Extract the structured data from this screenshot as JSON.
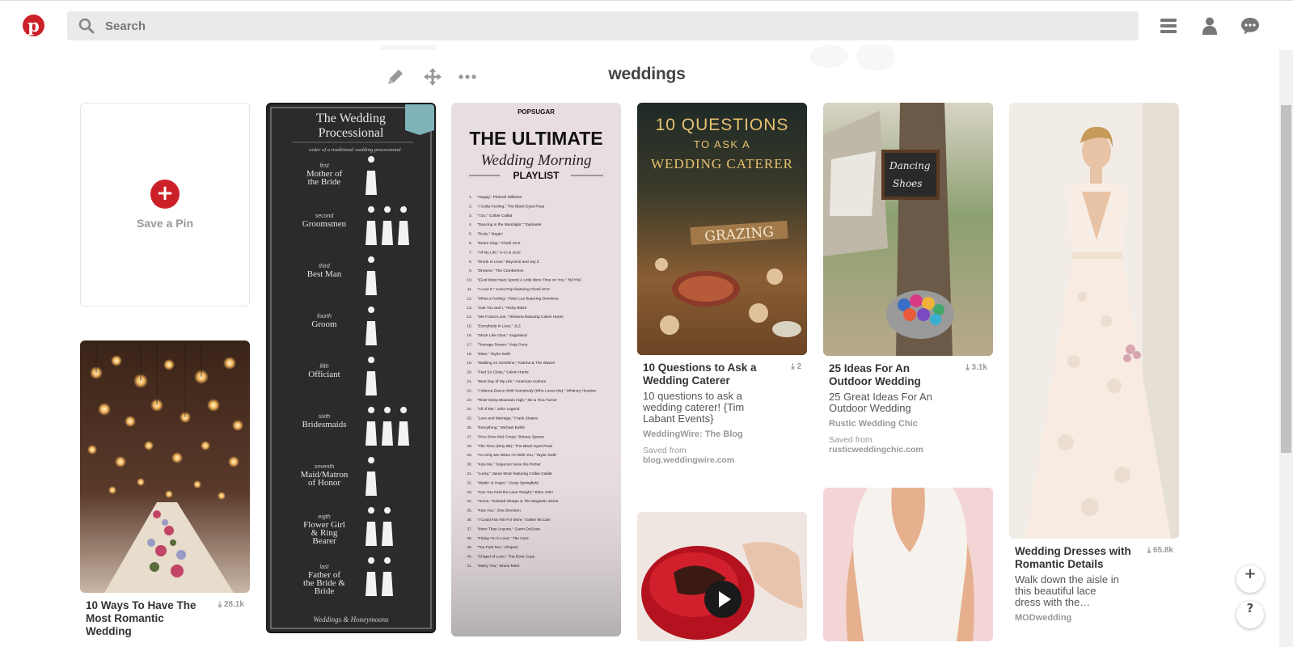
{
  "header": {
    "search_placeholder": "Search",
    "brand_color": "#cb2027"
  },
  "board": {
    "title": "weddings"
  },
  "save_card": {
    "label": "Save a Pin"
  },
  "pins": {
    "caterer": {
      "image_title_line1": "10 QUESTIONS",
      "image_title_line2": "TO ASK A",
      "image_title_line3": "WEDDING CATERER",
      "image_sign": "GRAZING",
      "title": "10 Questions to Ask a Wedding Caterer",
      "count": "2",
      "description": "10 questions to ask a wedding caterer! {Tim Labant Events}",
      "source": "WeddingWire: The Blog",
      "saved_from_label": "Saved from",
      "saved_from_url": "blog.weddingwire.com"
    },
    "outdoor": {
      "image_sign": "Dancing Shoes",
      "title": "25 Ideas For An Outdoor Wedding",
      "count": "3.1k",
      "description": "25 Great Ideas For An Outdoor Wedding",
      "source": "Rustic Wedding Chic",
      "saved_from_label": "Saved from",
      "saved_from_url": "rusticweddingchic.com"
    },
    "dress": {
      "title": "Wedding Dresses with Romantic Details",
      "count": "65.8k",
      "description": "Walk down the aisle in this beautiful lace dress with the…",
      "source": "MODwedding"
    },
    "romantic": {
      "title": "10 Ways To Have The Most Romantic Wedding",
      "count": "28.1k"
    },
    "processional": {
      "title_line1": "The Wedding",
      "title_line2": "Processional",
      "subtitle": "order of a traditional wedding processional",
      "roles": [
        {
          "ordinal": "first",
          "name": "Mother of the Bride"
        },
        {
          "ordinal": "second",
          "name": "Groomsmen"
        },
        {
          "ordinal": "third",
          "name": "Best Man"
        },
        {
          "ordinal": "fourth",
          "name": "Groom"
        },
        {
          "ordinal": "fifth",
          "name": "Officiant"
        },
        {
          "ordinal": "sixth",
          "name": "Bridesmaids"
        },
        {
          "ordinal": "seventh",
          "name": "Maid/Matron of Honor"
        },
        {
          "ordinal": "eigth",
          "name": "Flower Girl & Ring Bearer"
        },
        {
          "ordinal": "last",
          "name": "Father of the Bride & Bride"
        }
      ],
      "footer": "Weddings & Honeymoons"
    },
    "playlist": {
      "brand": "POPSUGAR",
      "title_line1": "THE ULTIMATE",
      "title_line2": "Wedding Morning",
      "title_line3": "PLAYLIST",
      "songs": [
        "\"Happy,\" Pharrell Williams",
        "\"I Gotta Feeling,\" The Black Eyed Peas",
        "\"I Do,\" Colbie Caillat",
        "\"Dancing in the Moonlight,\" Toploader",
        "\"Rude,\" Magic!",
        "\"Boom Clap,\" Charli XCX",
        "\"All My Life,\" K-Ci & JoJo",
        "\"Drunk in Love,\" Beyoncé and Jay Z",
        "\"Dreams,\" The Cranberries",
        "\"(God Must Have Spent) A Little More Time on You,\" 'NSYNC",
        "\"I Love It,\" Icona Pop featuring Charli XCX",
        "\"What a Feeling,\" Peter Luo featuring Dominica",
        "\"Just You and I,\" Ricky Blaze",
        "\"We Found Love,\" Rihanna featuring Calvin Harris",
        "\"Everybody in Love,\" JLS",
        "\"Stuck Like Glue,\" Sugarland",
        "\"Teenage Dream,\" Katy Perry",
        "\"Mine,\" Taylor Swift",
        "\"Walking on Sunshine,\" Katrina & The Waves",
        "\"Feel So Close,\" Calvin Harris",
        "\"Best Day of My Life,\" American Authors",
        "\"I Wanna Dance With Somebody (Who Loves Me),\" Whitney Houston",
        "\"River Deep Mountain High,\" Ike & Tina Turner",
        "\"All of Me,\" John Legend",
        "\"Love and Marriage,\" Frank Sinatra",
        "\"Everything,\" Michael Bublé",
        "\"(You Drive Me) Crazy,\" Britney Spears",
        "\"The Time (Dirty Bit),\" The Black Eyed Peas",
        "\"I'm Only Me When I'm With You,\" Taylor Swift",
        "\"Kiss Me,\" Sixpence None the Richer",
        "\"Lucky,\" Jason Mraz featuring Colbie Caillat",
        "\"Waitin' & Hopin',\" Dusty Springfield",
        "\"Can You Feel the Love Tonight,\" Elton John",
        "\"Home,\" Edward Sharpe & The Magnetic Zeros",
        "\"Kiss You,\" One Direction",
        "\"I Could Not Ask For More,\" Edwin McCain",
        "\"More Than Anyone,\" Gavin DeGraw",
        "\"Friday I'm in Love,\" The Cure",
        "\"Too Fast Too,\" Afrojack",
        "\"Chapel of Love,\" The Dixie Cups",
        "\"Marry You,\" Bruno Mars"
      ]
    }
  }
}
